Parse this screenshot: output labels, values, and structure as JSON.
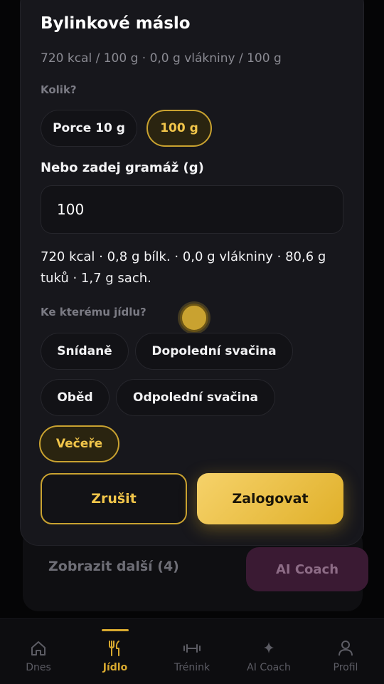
{
  "sheet": {
    "title": "Bylinkové máslo",
    "subtitle": "720 kcal / 100 g · 0,0 g vlákniny / 100 g",
    "amount_label": "Kolik?",
    "portions": [
      {
        "label": "Porce 10 g",
        "active": false
      },
      {
        "label": "100 g",
        "active": true
      }
    ],
    "grams_label": "Nebo zadej gramáž (g)",
    "grams_value": "100",
    "nutrition_summary": "720 kcal · 0,8 g bílk. · 0,0 g vlákniny · 80,6 g tuků · 1,7 g sach.",
    "meal_label": "Ke kterému jídlu?",
    "meals": [
      {
        "label": "Snídaně",
        "active": false
      },
      {
        "label": "Dopolední svačina",
        "active": false
      },
      {
        "label": "Oběd",
        "active": false
      },
      {
        "label": "Odpolední svačina",
        "active": false
      },
      {
        "label": "Večeře",
        "active": true
      }
    ],
    "cancel_label": "Zrušit",
    "confirm_label": "Zalogovat"
  },
  "background": {
    "show_more_label": "Zobrazit další (4)",
    "ai_coach_label": "AI Coach"
  },
  "nav": {
    "items": [
      {
        "label": "Dnes",
        "icon": "home-icon",
        "active": false
      },
      {
        "label": "Jídlo",
        "icon": "fork-knife-icon",
        "active": true
      },
      {
        "label": "Trénink",
        "icon": "dumbbell-icon",
        "active": false
      },
      {
        "label": "AI Coach",
        "icon": "sparkle-icon",
        "active": false
      },
      {
        "label": "Profil",
        "icon": "user-icon",
        "active": false
      }
    ]
  },
  "colors": {
    "accent": "#d8a92f",
    "background": "#050506",
    "sheet": "#17171c"
  }
}
